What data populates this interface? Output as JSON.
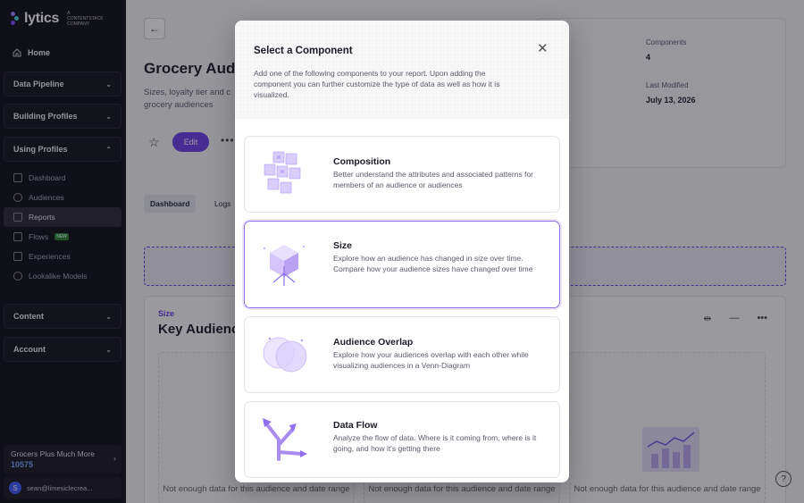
{
  "brand": {
    "name": "lytics",
    "tagline": "A CONTENTSTACK COMPANY"
  },
  "sidebar": {
    "home": "Home",
    "sections": [
      {
        "label": "Data Pipeline"
      },
      {
        "label": "Building Profiles"
      },
      {
        "label": "Using Profiles"
      },
      {
        "label": "Content"
      },
      {
        "label": "Account"
      }
    ],
    "using_profiles_items": [
      {
        "label": "Dashboard",
        "icon": "chart-icon"
      },
      {
        "label": "Audiences",
        "icon": "pie-icon"
      },
      {
        "label": "Reports",
        "icon": "reports-icon"
      },
      {
        "label": "Flows",
        "icon": "flows-icon",
        "badge": "NEW"
      },
      {
        "label": "Experiences",
        "icon": "experiences-icon"
      },
      {
        "label": "Lookalike Models",
        "icon": "lookalike-icon"
      }
    ],
    "account_name": "Grocers Plus Much More",
    "account_id": "10575",
    "user_initial": "S",
    "user_email": "sean@limesiclecrea..."
  },
  "page": {
    "title": "Grocery Audi",
    "description": "Sizes, loyalty tier and c grocery audiences",
    "edit_label": "Edit",
    "meta": {
      "components_label": "Components",
      "components_value": "4",
      "modified_label": "Last Modified",
      "modified_value": "July 13, 2026"
    },
    "tabs": [
      "Dashboard",
      "Logs"
    ],
    "widget": {
      "kicker": "Size",
      "title": "Key Audience",
      "empty_message": "Not enough data for this audience and date range"
    },
    "help": "?"
  },
  "modal": {
    "title": "Select a Component",
    "description": "Add one of the following components to your report. Upon adding the component you can further customize the type of data as well as how it is visualized.",
    "components": [
      {
        "title": "Composition",
        "description": "Better understand the attributes and associated patterns for members of an audience or audiences",
        "icon": "cubes-icon"
      },
      {
        "title": "Size",
        "description": "Explore how an audience has changed in size over time. Compare how your audience sizes have changed over time",
        "icon": "size-cube-icon"
      },
      {
        "title": "Audience Overlap",
        "description": "Explore how your audiences overlap with each other while visualizing audiences in a Venn-Diagram",
        "icon": "venn-icon"
      },
      {
        "title": "Data Flow",
        "description": "Analyze the flow of data. Where is it coming from, where is it going, and how it's getting there",
        "icon": "arrows-icon"
      }
    ],
    "selected_index": 1
  },
  "colors": {
    "accent": "#6c3ee8",
    "sidebar_bg": "#0f0e17",
    "selected_border": "#8f6ff0"
  }
}
